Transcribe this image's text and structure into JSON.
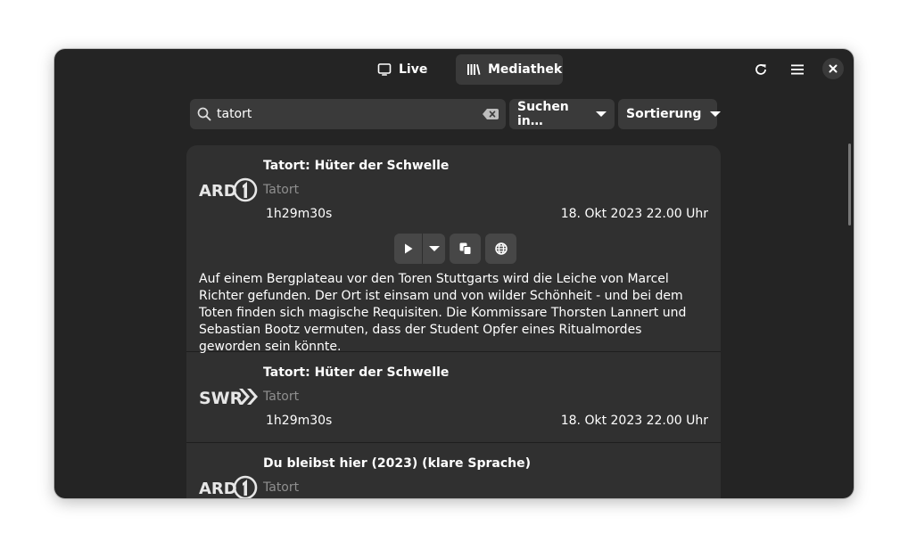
{
  "header": {
    "live_label": "Live",
    "mediathek_label": "Mediathek"
  },
  "search": {
    "value": "tatort",
    "search_in_label": "Suchen in…",
    "sort_label": "Sortierung"
  },
  "results": [
    {
      "channel": "ARD",
      "title": "Tatort: Hüter der Schwelle",
      "subtitle": "Tatort",
      "duration": "1h29m30s",
      "date": "18. Okt 2023 22.00 Uhr",
      "description": "Auf einem Bergplateau vor den Toren Stuttgarts wird die Leiche von Marcel Richter gefunden. Der Ort ist einsam und von wilder Schönheit - und bei dem Toten finden sich magische Requisiten. Die  Kommissare Thorsten Lannert und Sebastian Bootz vermuten, dass der Student Opfer eines Ritualmordes geworden sein könnte."
    },
    {
      "channel": "SWR",
      "title": "Tatort: Hüter der Schwelle",
      "subtitle": "Tatort",
      "duration": "1h29m30s",
      "date": "18. Okt 2023 22.00 Uhr"
    },
    {
      "channel": "ARD",
      "title": "Du bleibst hier (2023) (klare Sprache)",
      "subtitle": "Tatort"
    }
  ],
  "icons": {
    "live": "tv-icon",
    "mediathek": "library-icon",
    "refresh": "refresh-icon",
    "menu": "hamburger-menu-icon",
    "close": "close-icon",
    "search": "search-icon",
    "clear": "clear-text-icon",
    "play": "play-icon",
    "copy": "copy-icon",
    "web": "globe-icon"
  },
  "colors": {
    "window_bg": "#242424",
    "card_bg": "#303030",
    "control_bg": "#3a3a3a",
    "button_bg": "#474747",
    "text": "#ffffff",
    "dim_text": "#8f8f8f"
  }
}
